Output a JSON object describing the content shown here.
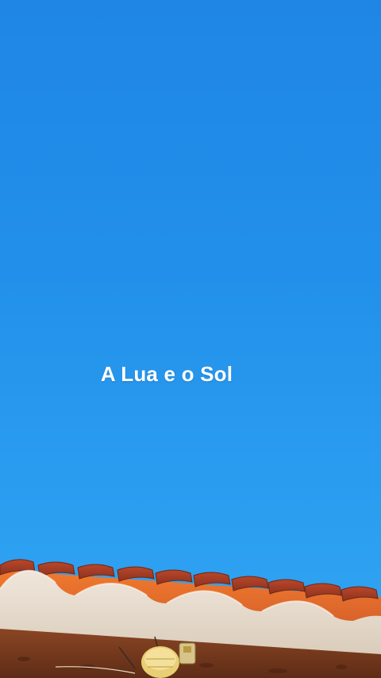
{
  "video": {
    "caption": "A Lua e o Sol"
  },
  "colors": {
    "sky_top": "#1f86e6",
    "sky_bottom": "#31a6f2",
    "caption_text": "#ffffff",
    "roof_tile": "#c8532c",
    "roof_tile_light": "#e8742f",
    "wall_cream": "#e9ded0",
    "beam_brown": "#7a3d20"
  },
  "icons": [
    "roof-tiles-scene",
    "lamp-fixture-icon"
  ]
}
